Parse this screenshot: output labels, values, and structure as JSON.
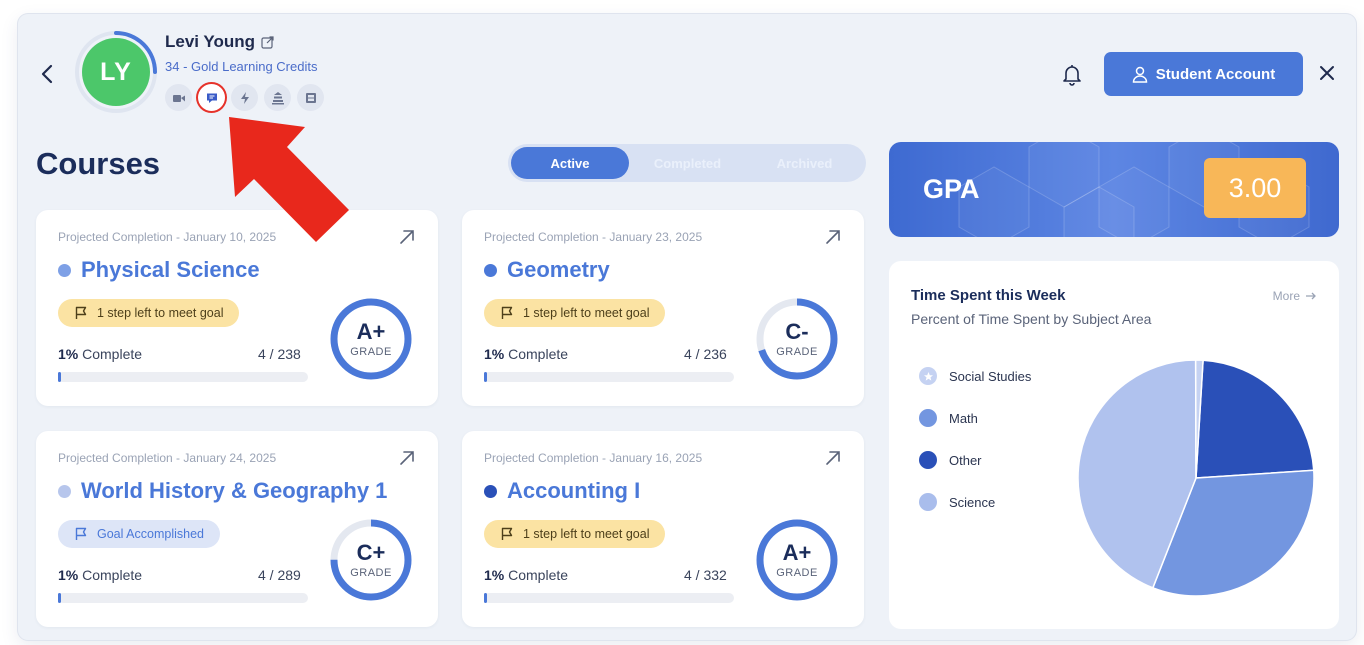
{
  "user": {
    "initials": "LY",
    "name": "Levi Young",
    "credits": "34 - Gold Learning Credits",
    "quick_icons": [
      {
        "icon": "video-icon",
        "active": false
      },
      {
        "icon": "chat-icon",
        "active": true
      },
      {
        "icon": "lightning-icon",
        "active": false
      },
      {
        "icon": "stack-icon",
        "active": false
      },
      {
        "icon": "film-icon",
        "active": false
      }
    ]
  },
  "header": {
    "student_account_label": "Student Account"
  },
  "courses": {
    "title": "Courses",
    "tabs": [
      "Active",
      "Completed",
      "Archived"
    ],
    "active_tab": "Active",
    "items": [
      {
        "projected": "Projected Completion - January 10, 2025",
        "name": "Physical Science",
        "dot_color": "#7ea0e6",
        "status": "1 step left to meet goal",
        "status_type": "goal",
        "percent_label": "1%",
        "complete_label": "Complete",
        "steps": "4 / 238",
        "progress": 0.01,
        "grade": "A+",
        "grade_label": "GRADE",
        "ring_fraction": 1.0
      },
      {
        "projected": "Projected Completion - January 23, 2025",
        "name": "Geometry",
        "dot_color": "#4a78d8",
        "status": "1 step left to meet goal",
        "status_type": "goal",
        "percent_label": "1%",
        "complete_label": "Complete",
        "steps": "4 / 236",
        "progress": 0.01,
        "grade": "C-",
        "grade_label": "GRADE",
        "ring_fraction": 0.7
      },
      {
        "projected": "Projected Completion - January 24, 2025",
        "name": "World History & Geography 1",
        "dot_color": "#b7c6ec",
        "status": "Goal Accomplished",
        "status_type": "done",
        "percent_label": "1%",
        "complete_label": "Complete",
        "steps": "4 / 289",
        "progress": 0.01,
        "grade": "C+",
        "grade_label": "GRADE",
        "ring_fraction": 0.75
      },
      {
        "projected": "Projected Completion - January 16, 2025",
        "name": "Accounting I",
        "dot_color": "#2a50b8",
        "status": "1 step left to meet goal",
        "status_type": "goal",
        "percent_label": "1%",
        "complete_label": "Complete",
        "steps": "4 / 332",
        "progress": 0.01,
        "grade": "A+",
        "grade_label": "GRADE",
        "ring_fraction": 1.0
      }
    ]
  },
  "gpa": {
    "label": "GPA",
    "value": "3.00"
  },
  "time_spent": {
    "title": "Time Spent this Week",
    "subtitle": "Percent of Time Spent by Subject Area",
    "more_label": "More",
    "legend": [
      {
        "label": "Social Studies",
        "color": "#c5d2f2",
        "icon": "star-icon"
      },
      {
        "label": "Math",
        "color": "#7396e0"
      },
      {
        "label": "Other",
        "color": "#2a50b8"
      },
      {
        "label": "Science",
        "color": "#a9bdec"
      }
    ]
  },
  "chart_data": {
    "type": "pie",
    "title": "Time Spent this Week",
    "subtitle": "Percent of Time Spent by Subject Area",
    "slices": [
      {
        "label": "Other",
        "value": 23,
        "color": "#2a50b8"
      },
      {
        "label": "Math",
        "value": 32,
        "color": "#7396e0"
      },
      {
        "label": "Science",
        "value": 44,
        "color": "#b0c2ee"
      },
      {
        "label": "Social Studies",
        "value": 1,
        "color": "#c5d2f2"
      }
    ]
  }
}
